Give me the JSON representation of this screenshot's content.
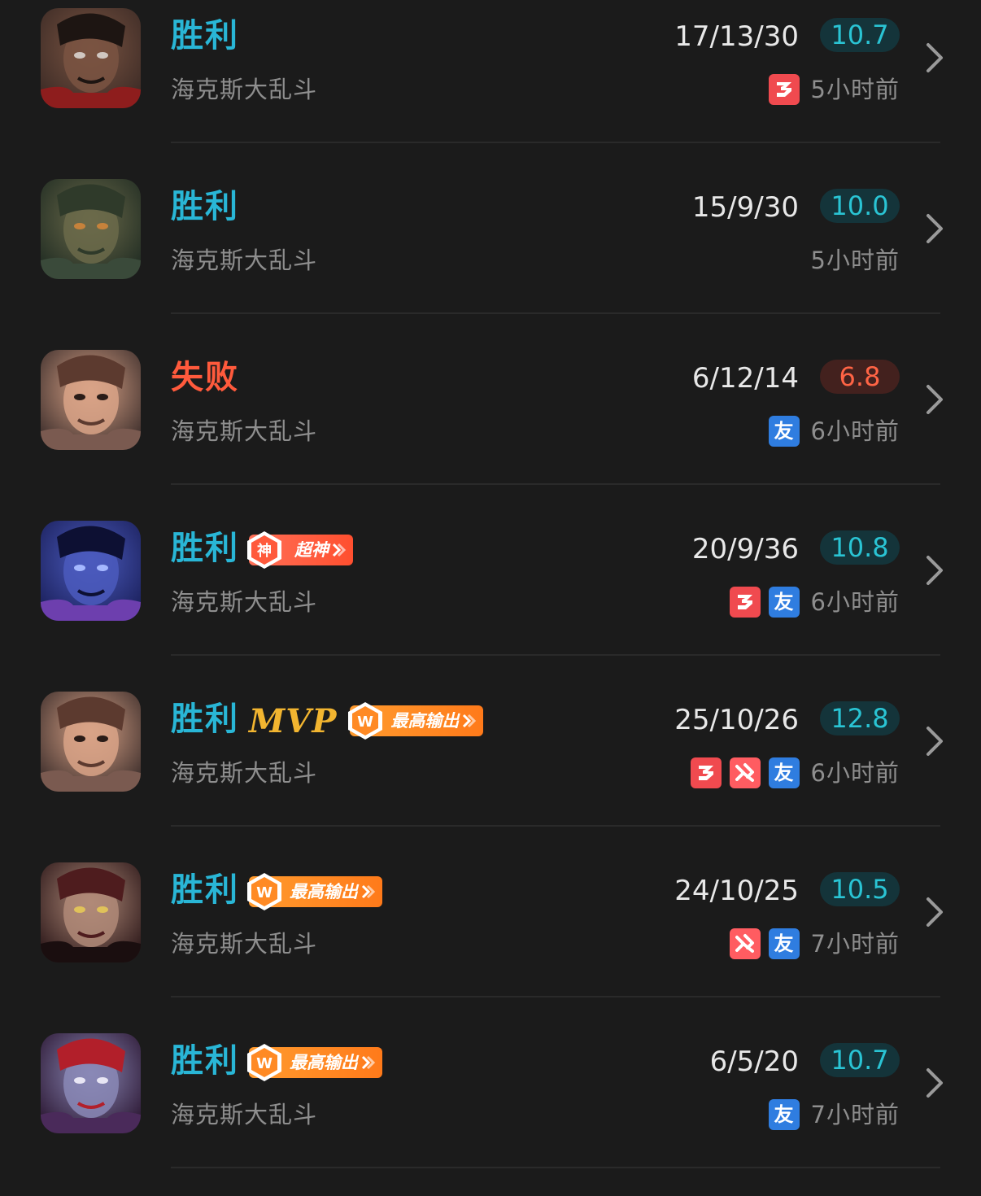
{
  "matches": [
    {
      "result": "胜利",
      "outcome": "win",
      "mode": "海克斯大乱斗",
      "kda": "17/13/30",
      "score": "10.7",
      "time": "5小时前",
      "badges": [],
      "mvp": "",
      "tags": [
        "triple"
      ],
      "hero_icon": "hero-portrait-dark-skinned"
    },
    {
      "result": "胜利",
      "outcome": "win",
      "mode": "海克斯大乱斗",
      "kda": "15/9/30",
      "score": "10.0",
      "time": "5小时前",
      "badges": [],
      "mvp": "",
      "tags": [],
      "hero_icon": "hero-portrait-bearded-warrior"
    },
    {
      "result": "失败",
      "outcome": "loss",
      "mode": "海克斯大乱斗",
      "kda": "6/12/14",
      "score": "6.8",
      "time": "6小时前",
      "badges": [],
      "mvp": "",
      "tags": [
        "friend"
      ],
      "hero_icon": "hero-portrait-smirking-man"
    },
    {
      "result": "胜利",
      "outcome": "win",
      "mode": "海克斯大乱斗",
      "kda": "20/9/36",
      "score": "10.8",
      "time": "6小时前",
      "badges": [
        {
          "type": "super",
          "icon_text": "神",
          "text": "超神"
        }
      ],
      "mvp": "",
      "tags": [
        "triple",
        "friend"
      ],
      "hero_icon": "hero-portrait-cosmic-dragon"
    },
    {
      "result": "胜利",
      "outcome": "win",
      "mode": "海克斯大乱斗",
      "kda": "25/10/26",
      "score": "12.8",
      "time": "6小时前",
      "badges": [
        {
          "type": "damage",
          "icon_text": "W",
          "text": "最高输出"
        }
      ],
      "mvp": "MVP",
      "tags": [
        "triple",
        "quadra",
        "friend"
      ],
      "hero_icon": "hero-portrait-smirking-man"
    },
    {
      "result": "胜利",
      "outcome": "win",
      "mode": "海克斯大乱斗",
      "kda": "24/10/25",
      "score": "10.5",
      "time": "7小时前",
      "badges": [
        {
          "type": "damage",
          "icon_text": "W",
          "text": "最高输出"
        }
      ],
      "mvp": "",
      "tags": [
        "quadra",
        "friend"
      ],
      "hero_icon": "hero-portrait-dark-queen"
    },
    {
      "result": "胜利",
      "outcome": "win",
      "mode": "海克斯大乱斗",
      "kda": "6/5/20",
      "score": "10.7",
      "time": "7小时前",
      "badges": [
        {
          "type": "damage",
          "icon_text": "W",
          "text": "最高输出"
        }
      ],
      "mvp": "",
      "tags": [
        "friend"
      ],
      "hero_icon": "hero-portrait-demon-hunter"
    }
  ],
  "tag_labels": {
    "friend": "友"
  },
  "colors": {
    "win": "#29b6d6",
    "loss": "#ff5a3c",
    "background": "#1b1b1b",
    "badge_orange": "#ff8a24"
  }
}
